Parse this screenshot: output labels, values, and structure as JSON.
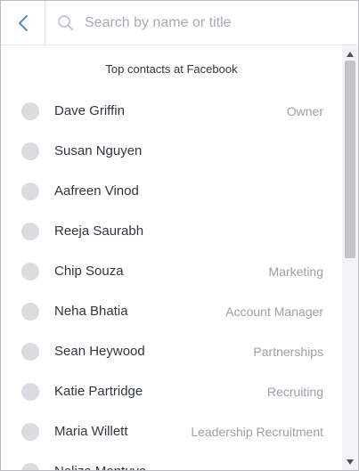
{
  "header": {
    "back_icon": "chevron-left-icon",
    "search_icon": "search-icon",
    "search_placeholder": "Search by name or title",
    "search_value": ""
  },
  "list": {
    "heading": "Top contacts at Facebook",
    "contacts": [
      {
        "name": "Dave Griffin",
        "title": "Owner"
      },
      {
        "name": "Susan Nguyen",
        "title": ""
      },
      {
        "name": "Aafreen Vinod",
        "title": ""
      },
      {
        "name": "Reeja Saurabh",
        "title": ""
      },
      {
        "name": "Chip Souza",
        "title": "Marketing"
      },
      {
        "name": "Neha Bhatia",
        "title": "Account Manager"
      },
      {
        "name": "Sean Heywood",
        "title": "Partnerships"
      },
      {
        "name": "Katie Partridge",
        "title": "Recruiting"
      },
      {
        "name": "Maria Willett",
        "title": "Leadership Recruitment"
      },
      {
        "name": "Neliza Montuya",
        "title": ""
      }
    ]
  },
  "colors": {
    "accent": "#3b82c4",
    "avatar": "#dadcdf",
    "text": "#2f3542",
    "muted": "#9aa0a8"
  }
}
